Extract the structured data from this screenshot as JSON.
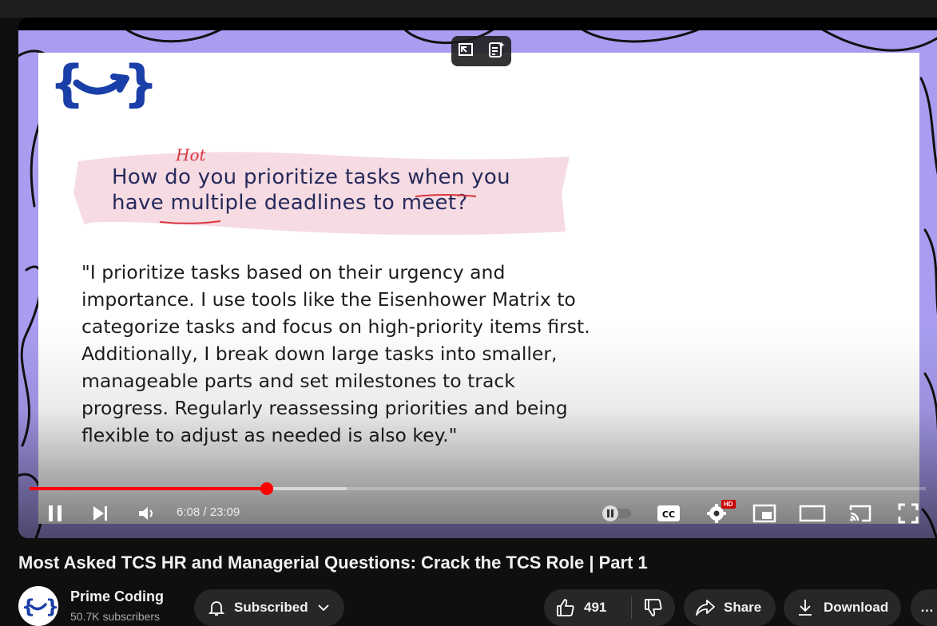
{
  "video": {
    "slide_question_line1": "How do you prioritize tasks when you",
    "slide_question_line2": "have multiple deadlines to meet?",
    "slide_annotation": "Hot",
    "slide_answer": "\"I prioritize tasks based on their urgency and\nimportance. I use tools like the Eisenhower Matrix to\ncategorize tasks and focus on high-priority items first.\nAdditionally, I break down large tasks into smaller,\nmanageable parts and set milestones to track\nprogress. Regularly reassessing priorities and being\nflexible to adjust as needed is also key.\""
  },
  "player": {
    "current_time": "6:08",
    "duration": "23:09",
    "time_display": "6:08 / 23:09",
    "progress_fraction": 0.265,
    "buffered_fraction": 0.354,
    "quality_badge": "HD",
    "cc_label": "CC",
    "accent_color": "#ff0000",
    "icons": [
      "pause-icon",
      "next-icon",
      "volume-icon",
      "autoplay-toggle-icon",
      "cc-icon",
      "settings-icon",
      "miniplayer-icon",
      "theater-icon",
      "cast-icon",
      "fullscreen-icon",
      "stable-volume-icon",
      "summary-icon"
    ]
  },
  "meta": {
    "title": "Most Asked TCS HR and Managerial Questions: Crack the TCS Role | Part 1",
    "channel_name": "Prime Coding",
    "subscribers": "50.7K subscribers",
    "subscribe_label": "Subscribed",
    "like_count": "491",
    "share_label": "Share",
    "download_label": "Download",
    "more_label": "…"
  }
}
